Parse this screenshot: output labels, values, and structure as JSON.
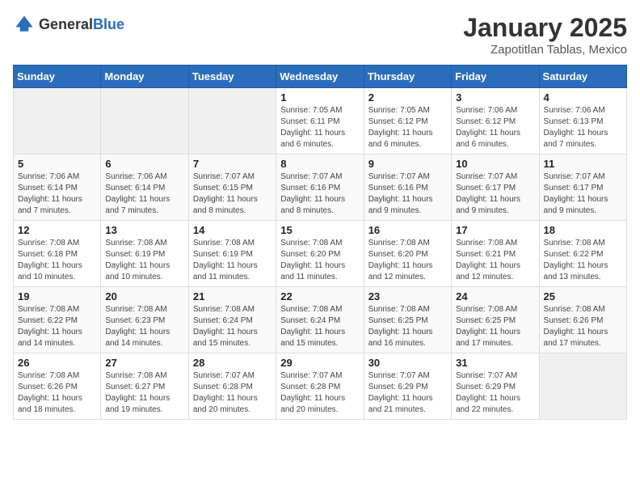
{
  "header": {
    "logo_general": "General",
    "logo_blue": "Blue",
    "month_title": "January 2025",
    "location": "Zapotitlan Tablas, Mexico"
  },
  "days_of_week": [
    "Sunday",
    "Monday",
    "Tuesday",
    "Wednesday",
    "Thursday",
    "Friday",
    "Saturday"
  ],
  "weeks": [
    [
      {
        "day": "",
        "info": ""
      },
      {
        "day": "",
        "info": ""
      },
      {
        "day": "",
        "info": ""
      },
      {
        "day": "1",
        "info": "Sunrise: 7:05 AM\nSunset: 6:11 PM\nDaylight: 11 hours and 6 minutes."
      },
      {
        "day": "2",
        "info": "Sunrise: 7:05 AM\nSunset: 6:12 PM\nDaylight: 11 hours and 6 minutes."
      },
      {
        "day": "3",
        "info": "Sunrise: 7:06 AM\nSunset: 6:12 PM\nDaylight: 11 hours and 6 minutes."
      },
      {
        "day": "4",
        "info": "Sunrise: 7:06 AM\nSunset: 6:13 PM\nDaylight: 11 hours and 7 minutes."
      }
    ],
    [
      {
        "day": "5",
        "info": "Sunrise: 7:06 AM\nSunset: 6:14 PM\nDaylight: 11 hours and 7 minutes."
      },
      {
        "day": "6",
        "info": "Sunrise: 7:06 AM\nSunset: 6:14 PM\nDaylight: 11 hours and 7 minutes."
      },
      {
        "day": "7",
        "info": "Sunrise: 7:07 AM\nSunset: 6:15 PM\nDaylight: 11 hours and 8 minutes."
      },
      {
        "day": "8",
        "info": "Sunrise: 7:07 AM\nSunset: 6:16 PM\nDaylight: 11 hours and 8 minutes."
      },
      {
        "day": "9",
        "info": "Sunrise: 7:07 AM\nSunset: 6:16 PM\nDaylight: 11 hours and 9 minutes."
      },
      {
        "day": "10",
        "info": "Sunrise: 7:07 AM\nSunset: 6:17 PM\nDaylight: 11 hours and 9 minutes."
      },
      {
        "day": "11",
        "info": "Sunrise: 7:07 AM\nSunset: 6:17 PM\nDaylight: 11 hours and 9 minutes."
      }
    ],
    [
      {
        "day": "12",
        "info": "Sunrise: 7:08 AM\nSunset: 6:18 PM\nDaylight: 11 hours and 10 minutes."
      },
      {
        "day": "13",
        "info": "Sunrise: 7:08 AM\nSunset: 6:19 PM\nDaylight: 11 hours and 10 minutes."
      },
      {
        "day": "14",
        "info": "Sunrise: 7:08 AM\nSunset: 6:19 PM\nDaylight: 11 hours and 11 minutes."
      },
      {
        "day": "15",
        "info": "Sunrise: 7:08 AM\nSunset: 6:20 PM\nDaylight: 11 hours and 11 minutes."
      },
      {
        "day": "16",
        "info": "Sunrise: 7:08 AM\nSunset: 6:20 PM\nDaylight: 11 hours and 12 minutes."
      },
      {
        "day": "17",
        "info": "Sunrise: 7:08 AM\nSunset: 6:21 PM\nDaylight: 11 hours and 12 minutes."
      },
      {
        "day": "18",
        "info": "Sunrise: 7:08 AM\nSunset: 6:22 PM\nDaylight: 11 hours and 13 minutes."
      }
    ],
    [
      {
        "day": "19",
        "info": "Sunrise: 7:08 AM\nSunset: 6:22 PM\nDaylight: 11 hours and 14 minutes."
      },
      {
        "day": "20",
        "info": "Sunrise: 7:08 AM\nSunset: 6:23 PM\nDaylight: 11 hours and 14 minutes."
      },
      {
        "day": "21",
        "info": "Sunrise: 7:08 AM\nSunset: 6:24 PM\nDaylight: 11 hours and 15 minutes."
      },
      {
        "day": "22",
        "info": "Sunrise: 7:08 AM\nSunset: 6:24 PM\nDaylight: 11 hours and 15 minutes."
      },
      {
        "day": "23",
        "info": "Sunrise: 7:08 AM\nSunset: 6:25 PM\nDaylight: 11 hours and 16 minutes."
      },
      {
        "day": "24",
        "info": "Sunrise: 7:08 AM\nSunset: 6:25 PM\nDaylight: 11 hours and 17 minutes."
      },
      {
        "day": "25",
        "info": "Sunrise: 7:08 AM\nSunset: 6:26 PM\nDaylight: 11 hours and 17 minutes."
      }
    ],
    [
      {
        "day": "26",
        "info": "Sunrise: 7:08 AM\nSunset: 6:26 PM\nDaylight: 11 hours and 18 minutes."
      },
      {
        "day": "27",
        "info": "Sunrise: 7:08 AM\nSunset: 6:27 PM\nDaylight: 11 hours and 19 minutes."
      },
      {
        "day": "28",
        "info": "Sunrise: 7:07 AM\nSunset: 6:28 PM\nDaylight: 11 hours and 20 minutes."
      },
      {
        "day": "29",
        "info": "Sunrise: 7:07 AM\nSunset: 6:28 PM\nDaylight: 11 hours and 20 minutes."
      },
      {
        "day": "30",
        "info": "Sunrise: 7:07 AM\nSunset: 6:29 PM\nDaylight: 11 hours and 21 minutes."
      },
      {
        "day": "31",
        "info": "Sunrise: 7:07 AM\nSunset: 6:29 PM\nDaylight: 11 hours and 22 minutes."
      },
      {
        "day": "",
        "info": ""
      }
    ]
  ]
}
